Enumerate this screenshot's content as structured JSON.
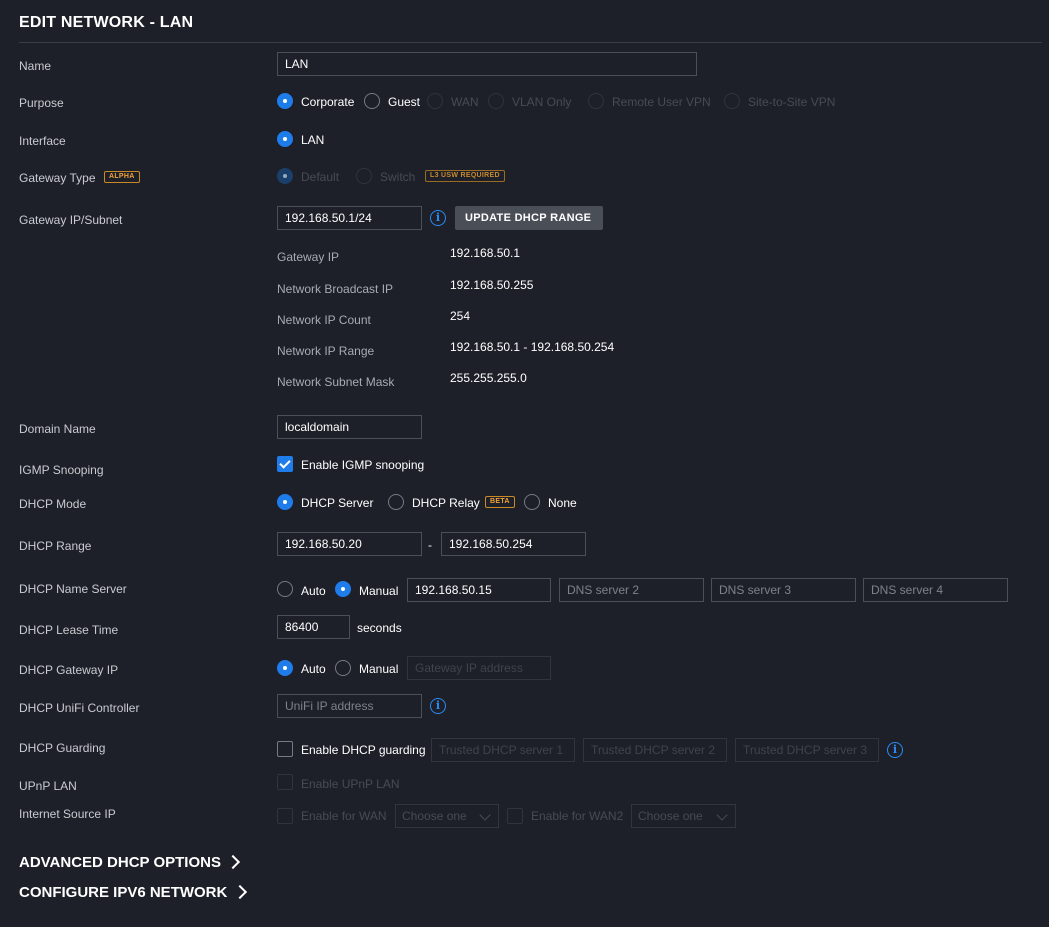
{
  "title": "EDIT NETWORK - LAN",
  "colors": {
    "background": "#1d2028",
    "accent": "#1f7ceb",
    "badge": "#f2a33a"
  },
  "labels": {
    "name": "Name",
    "purpose": "Purpose",
    "interface": "Interface",
    "gateway_type": "Gateway Type",
    "gateway_ip_subnet": "Gateway IP/Subnet",
    "domain_name": "Domain Name",
    "igmp_snooping": "IGMP Snooping",
    "dhcp_mode": "DHCP Mode",
    "dhcp_range": "DHCP Range",
    "dhcp_name_server": "DHCP Name Server",
    "dhcp_lease_time": "DHCP Lease Time",
    "dhcp_gateway_ip": "DHCP Gateway IP",
    "dhcp_unifi_controller": "DHCP UniFi Controller",
    "dhcp_guarding": "DHCP Guarding",
    "upnp_lan": "UPnP LAN",
    "internet_source_ip": "Internet Source IP"
  },
  "name_value": "LAN",
  "purpose_options": [
    "Corporate",
    "Guest",
    "WAN",
    "VLAN Only",
    "Remote User VPN",
    "Site-to-Site VPN"
  ],
  "purpose_selected": "Corporate",
  "interface_option": "LAN",
  "gateway_type": {
    "badge": "ALPHA",
    "options": [
      "Default",
      "Switch"
    ],
    "switch_badge": "L3 USW REQUIRED"
  },
  "gateway": {
    "value": "192.168.50.1/24",
    "update_button": "UPDATE DHCP RANGE",
    "info_icon": "info-icon",
    "details": [
      {
        "label": "Gateway IP",
        "value": "192.168.50.1"
      },
      {
        "label": "Network Broadcast IP",
        "value": "192.168.50.255"
      },
      {
        "label": "Network IP Count",
        "value": "254"
      },
      {
        "label": "Network IP Range",
        "value": "192.168.50.1 - 192.168.50.254"
      },
      {
        "label": "Network Subnet Mask",
        "value": "255.255.255.0"
      }
    ]
  },
  "domain_name_value": "localdomain",
  "igmp_checkbox_label": "Enable IGMP snooping",
  "dhcp_mode": {
    "options": [
      "DHCP Server",
      "DHCP Relay",
      "None"
    ],
    "relay_badge": "BETA",
    "selected": "DHCP Server"
  },
  "dhcp_range": {
    "start": "192.168.50.20",
    "separator": "-",
    "end": "192.168.50.254"
  },
  "name_server": {
    "options": [
      "Auto",
      "Manual"
    ],
    "selected": "Manual",
    "dns1": "192.168.50.15",
    "dns2_placeholder": "DNS server 2",
    "dns3_placeholder": "DNS server 3",
    "dns4_placeholder": "DNS server 4"
  },
  "lease_time": {
    "value": "86400",
    "unit": "seconds"
  },
  "dhcp_gateway": {
    "options": [
      "Auto",
      "Manual"
    ],
    "selected": "Auto",
    "placeholder": "Gateway IP address"
  },
  "unifi_controller_placeholder": "UniFi IP address",
  "dhcp_guarding": {
    "checkbox_label": "Enable DHCP guarding",
    "server1_placeholder": "Trusted DHCP server 1",
    "server2_placeholder": "Trusted DHCP server 2",
    "server3_placeholder": "Trusted DHCP server 3"
  },
  "upnp_checkbox_label": "Enable UPnP LAN",
  "internet_source": {
    "wan_label": "Enable for WAN",
    "wan_select": "Choose one",
    "wan2_label": "Enable for WAN2",
    "wan2_select": "Choose one"
  },
  "advanced_dhcp": "ADVANCED DHCP OPTIONS",
  "configure_ipv6": "CONFIGURE IPV6 NETWORK"
}
